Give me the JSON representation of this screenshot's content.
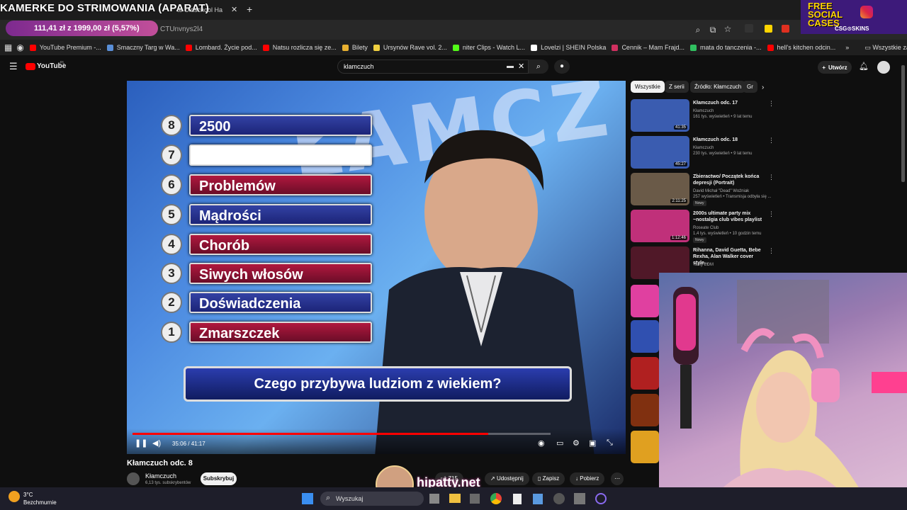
{
  "browser": {
    "stream_overlay_title": "KAMERKE DO STRIMOWANIA (APARAT)",
    "tab_partial": "te Oldschool Ha",
    "price_pill": "111,41 zł z 1999,00 zł (5,57%)",
    "url": "CTUnvnys2l4",
    "bookmarks": [
      {
        "label": "YouTube Premium -...",
        "color": "#ff0000"
      },
      {
        "label": "Smaczny Targ w Wa...",
        "color": "#5a8fd8"
      },
      {
        "label": "Lombard. Życie pod...",
        "color": "#ff0000"
      },
      {
        "label": "Natsu rozlicza się ze...",
        "color": "#ff0000"
      },
      {
        "label": "Bilety",
        "color": "#e8b030"
      },
      {
        "label": "Ursynów Rave vol. 2...",
        "color": "#f0d040"
      },
      {
        "label": "niter Clips - Watch L...",
        "color": "#53fc18"
      },
      {
        "label": "Lovelzi | SHEIN Polska",
        "color": "#ffffff"
      },
      {
        "label": "Cennik – Mam Frajd...",
        "color": "#d03060"
      },
      {
        "label": "mata do tanczenia -...",
        "color": "#30c060"
      },
      {
        "label": "hell's kitchen odcin...",
        "color": "#ff0000"
      }
    ],
    "all_bookmarks": "Wszystkie zakładki"
  },
  "promo": {
    "line1": "FREE",
    "line2": "SOCIAL",
    "line3": "CASES",
    "brand": "CSG⊙SKINS"
  },
  "youtube": {
    "logo": "YouTube",
    "logo_sup": "PL",
    "search_value": "klamczuch",
    "create_label": "Utwórz"
  },
  "video": {
    "ladder": [
      {
        "n": "8",
        "text": "2500",
        "style": "blue"
      },
      {
        "n": "7",
        "text": "",
        "style": "white"
      },
      {
        "n": "6",
        "text": "Problemów",
        "style": "red"
      },
      {
        "n": "5",
        "text": "Mądrości",
        "style": "blue"
      },
      {
        "n": "4",
        "text": "Chorób",
        "style": "red"
      },
      {
        "n": "3",
        "text": "Siwych włosów",
        "style": "red"
      },
      {
        "n": "2",
        "text": "Doświadczenia",
        "style": "blue"
      },
      {
        "n": "1",
        "text": "Zmarszczek",
        "style": "red"
      }
    ],
    "question": "Czego przybywa ludziom z wiekiem?",
    "time": "35:06 / 41:17",
    "progress": 0.85,
    "title": "Kłamczuch odc. 8",
    "channel": "Kłamczuch",
    "subscribers": "6,13 tys. subskrybentów",
    "subscribe": "Subskrybuj",
    "likes": "715",
    "share": "Udostępnij",
    "save": "Zapisz",
    "download": "Pobierz"
  },
  "chips": [
    "Wszystkie",
    "Z serii",
    "Źródło: Kłamczuch",
    "Gr"
  ],
  "related": [
    {
      "title": "Kłamczuch odc. 17",
      "channel": "Kłamczuch",
      "meta": "161 tys. wyświetleń • 9 lat temu",
      "duration": "41:35",
      "new": "",
      "thumb": "#3a5cb0"
    },
    {
      "title": "Kłamczuch odc. 18",
      "channel": "Kłamczuch",
      "meta": "230 tys. wyświetleń • 9 lat temu",
      "duration": "45:27",
      "new": "",
      "thumb": "#3a5cb0"
    },
    {
      "title": "Zbieractwo/ Początek końca depresji (Portrait)",
      "channel": "David Michał \"Dead\" Woźniak",
      "meta": "257 wyświetleń • Transmisja odbyła się ...",
      "duration": "2:11:25",
      "new": "Nowy",
      "thumb": "#6a5a48"
    },
    {
      "title": "2000s ultimate party mix ~nostalgia club vibes playlist",
      "channel": "Roseate Club",
      "meta": "1,4 tys. wyświetleń • 10 godzin temu",
      "duration": "1:12:46",
      "new": "Nowy",
      "thumb": "#c0307a"
    },
    {
      "title": "Rihanna, David Guetta, Bebe Rexha, Alan Walker cover style...",
      "channel": "Tasty EDM",
      "meta": "",
      "duration": "",
      "new": "",
      "thumb": "#501828"
    }
  ],
  "taskbar": {
    "temp": "3°C",
    "weather": "Bezchmurnie",
    "search": "Wyszukaj"
  },
  "watermark": "hipatty.net"
}
